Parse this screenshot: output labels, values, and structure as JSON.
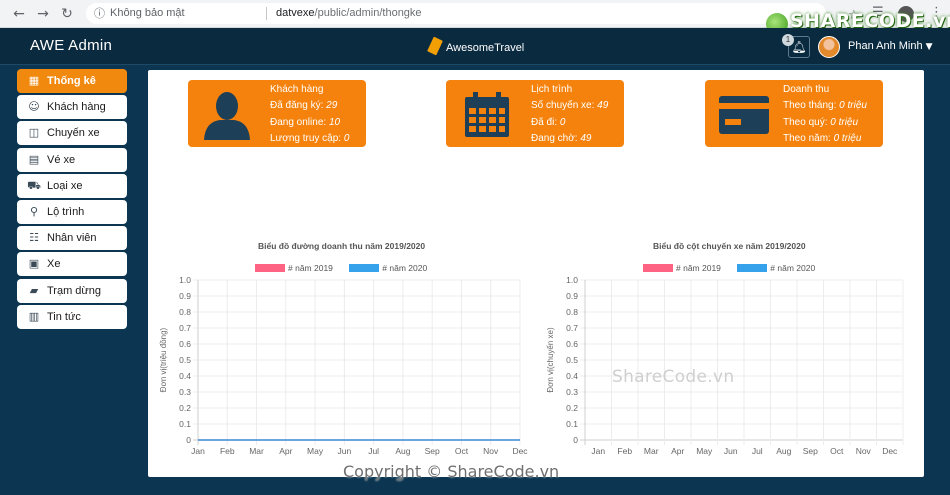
{
  "browser": {
    "insecure_label": "Không bảo mật",
    "url_host": "datvexe",
    "url_path": "/public/admin/thongke",
    "watermark_logo": "SHARECODE.vn"
  },
  "header": {
    "brand": "AWE Admin",
    "center_logo": "AwesomeTravel",
    "notification_count": "1",
    "user_name": "Phan Anh Minh"
  },
  "sidebar": {
    "items": [
      {
        "label": "Thống kê",
        "icon": "chart-icon",
        "glyph": "▦",
        "active": true
      },
      {
        "label": "Khách hàng",
        "icon": "handshake-icon",
        "glyph": "☺",
        "active": false
      },
      {
        "label": "Chuyến xe",
        "icon": "route-map-icon",
        "glyph": "◫",
        "active": false
      },
      {
        "label": "Vé xe",
        "icon": "ticket-icon",
        "glyph": "▤",
        "active": false
      },
      {
        "label": "Loại xe",
        "icon": "car-icon",
        "glyph": "⛟",
        "active": false
      },
      {
        "label": "Lộ trình",
        "icon": "route-icon",
        "glyph": "⚲",
        "active": false
      },
      {
        "label": "Nhân viên",
        "icon": "staff-icon",
        "glyph": "☷",
        "active": false
      },
      {
        "label": "Xe",
        "icon": "bus-icon",
        "glyph": "▣",
        "active": false
      },
      {
        "label": "Trạm dừng",
        "icon": "station-icon",
        "glyph": "▰",
        "active": false
      },
      {
        "label": "Tin tức",
        "icon": "news-icon",
        "glyph": "▥",
        "active": false
      }
    ]
  },
  "cards": {
    "customers": {
      "title": "Khách hàng",
      "registered_label": "Đã đăng ký:",
      "registered_value": "29",
      "online_label": "Đang online:",
      "online_value": "10",
      "visits_label": "Lượng truy cập:",
      "visits_value": "0"
    },
    "schedule": {
      "title": "Lịch trình",
      "trips_label": "Số chuyến xe:",
      "trips_value": "49",
      "done_label": "Đã đi:",
      "done_value": "0",
      "waiting_label": "Đang chờ:",
      "waiting_value": "49"
    },
    "revenue": {
      "title": "Doanh thu",
      "month_label": "Theo tháng:",
      "month_value": "0 triệu",
      "quarter_label": "Theo quý:",
      "quarter_value": "0 triệu",
      "year_label": "Theo năm:",
      "year_value": "0 triệu"
    }
  },
  "colors": {
    "accent": "#f5820c",
    "series_2019": "#ff6384",
    "series_2020": "#36a2eb"
  },
  "chart_data": [
    {
      "type": "line",
      "title": "Biểu đồ đường doanh thu năm 2019/2020",
      "ylabel": "Đơn vị(triệu đồng)",
      "xlabel": "",
      "categories": [
        "Jan",
        "Feb",
        "Mar",
        "Apr",
        "May",
        "Jun",
        "Jul",
        "Aug",
        "Sep",
        "Oct",
        "Nov",
        "Dec"
      ],
      "yticks": [
        "0",
        "0.1",
        "0.2",
        "0.3",
        "0.4",
        "0.5",
        "0.6",
        "0.7",
        "0.8",
        "0.9",
        "1.0"
      ],
      "ylim": [
        0,
        1
      ],
      "grid": true,
      "legend": "top",
      "series": [
        {
          "name": "# năm 2019",
          "values": [
            0,
            0,
            0,
            0,
            0,
            0,
            0,
            0,
            0,
            0,
            0,
            0
          ]
        },
        {
          "name": "# năm 2020",
          "values": [
            0,
            0,
            0,
            0,
            0,
            0,
            0,
            0,
            0,
            0,
            0,
            0
          ]
        }
      ]
    },
    {
      "type": "bar",
      "title": "Biểu đồ cột chuyến xe năm 2019/2020",
      "ylabel": "Đơn vị(chuyến xe)",
      "xlabel": "",
      "categories": [
        "Jan",
        "Feb",
        "Mar",
        "Apr",
        "May",
        "Jun",
        "Jul",
        "Aug",
        "Sep",
        "Oct",
        "Nov",
        "Dec"
      ],
      "yticks": [
        "0",
        "0.1",
        "0.2",
        "0.3",
        "0.4",
        "0.5",
        "0.6",
        "0.7",
        "0.8",
        "0.9",
        "1.0"
      ],
      "ylim": [
        0,
        1
      ],
      "grid": true,
      "legend": "top",
      "series": [
        {
          "name": "# năm 2019",
          "values": [
            0,
            0,
            0,
            0,
            0,
            0,
            0,
            0,
            0,
            0,
            0,
            0
          ]
        },
        {
          "name": "# năm 2020",
          "values": [
            0,
            0,
            0,
            0,
            0,
            0,
            0,
            0,
            0,
            0,
            0,
            0
          ]
        }
      ]
    }
  ],
  "watermarks": {
    "center": "ShareCode.vn",
    "footer": "Copyright © ShareCode.vn"
  }
}
